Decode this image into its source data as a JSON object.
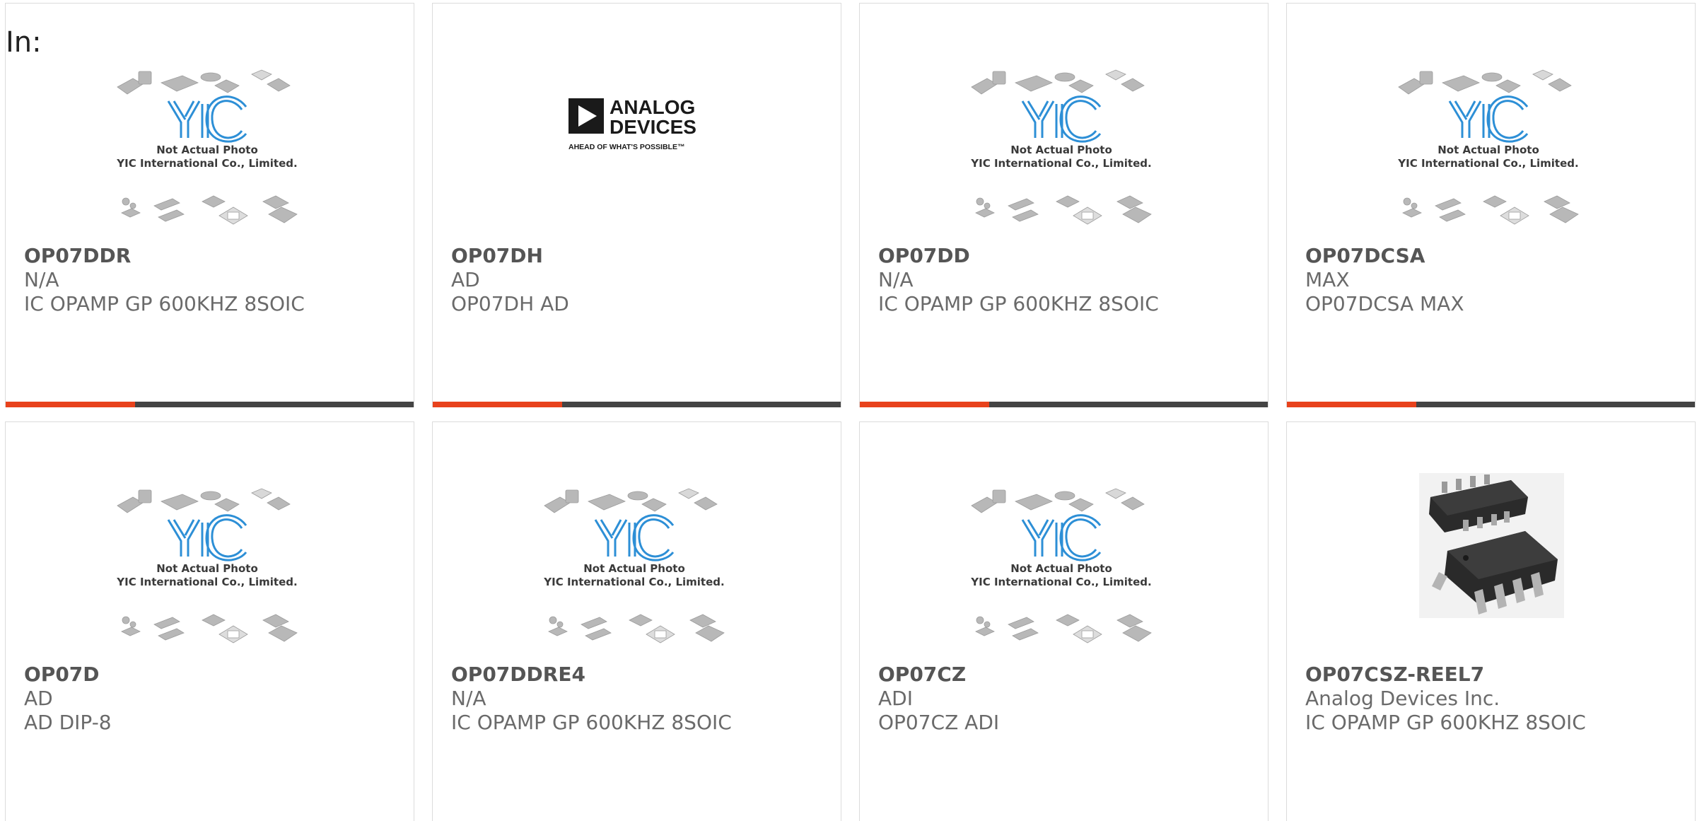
{
  "filter": {
    "label": "In:"
  },
  "placeholder": {
    "line1": "Not Actual Photo",
    "line2": "YIC International Co., Limited."
  },
  "brand_logo": {
    "line1": "ANALOG",
    "line2": "DEVICES",
    "tagline": "AHEAD OF WHAT'S POSSIBLE™"
  },
  "colors": {
    "accent": "#e8421c",
    "bar": "#444444",
    "yic_blue": "#2d8fd6",
    "gray_chip": "#b8b8b8"
  },
  "products": [
    {
      "part": "OP07DDR",
      "manufacturer": "N/A",
      "description": "IC OPAMP GP 600KHZ 8SOIC",
      "image": "placeholder"
    },
    {
      "part": "OP07DH",
      "manufacturer": "AD",
      "description": "OP07DH AD",
      "image": "analog-devices-logo"
    },
    {
      "part": "OP07DD",
      "manufacturer": "N/A",
      "description": "IC OPAMP GP 600KHZ 8SOIC",
      "image": "placeholder"
    },
    {
      "part": "OP07DCSA",
      "manufacturer": "MAX",
      "description": "OP07DCSA MAX",
      "image": "placeholder"
    },
    {
      "part": "OP07D",
      "manufacturer": "AD",
      "description": "AD DIP-8",
      "image": "placeholder"
    },
    {
      "part": "OP07DDRE4",
      "manufacturer": "N/A",
      "description": "IC OPAMP GP 600KHZ 8SOIC",
      "image": "placeholder"
    },
    {
      "part": "OP07CZ",
      "manufacturer": "ADI",
      "description": "OP07CZ ADI",
      "image": "placeholder"
    },
    {
      "part": "OP07CSZ-REEL7",
      "manufacturer": "Analog Devices Inc.",
      "description": "IC OPAMP GP 600KHZ 8SOIC",
      "image": "soic-photo"
    }
  ]
}
